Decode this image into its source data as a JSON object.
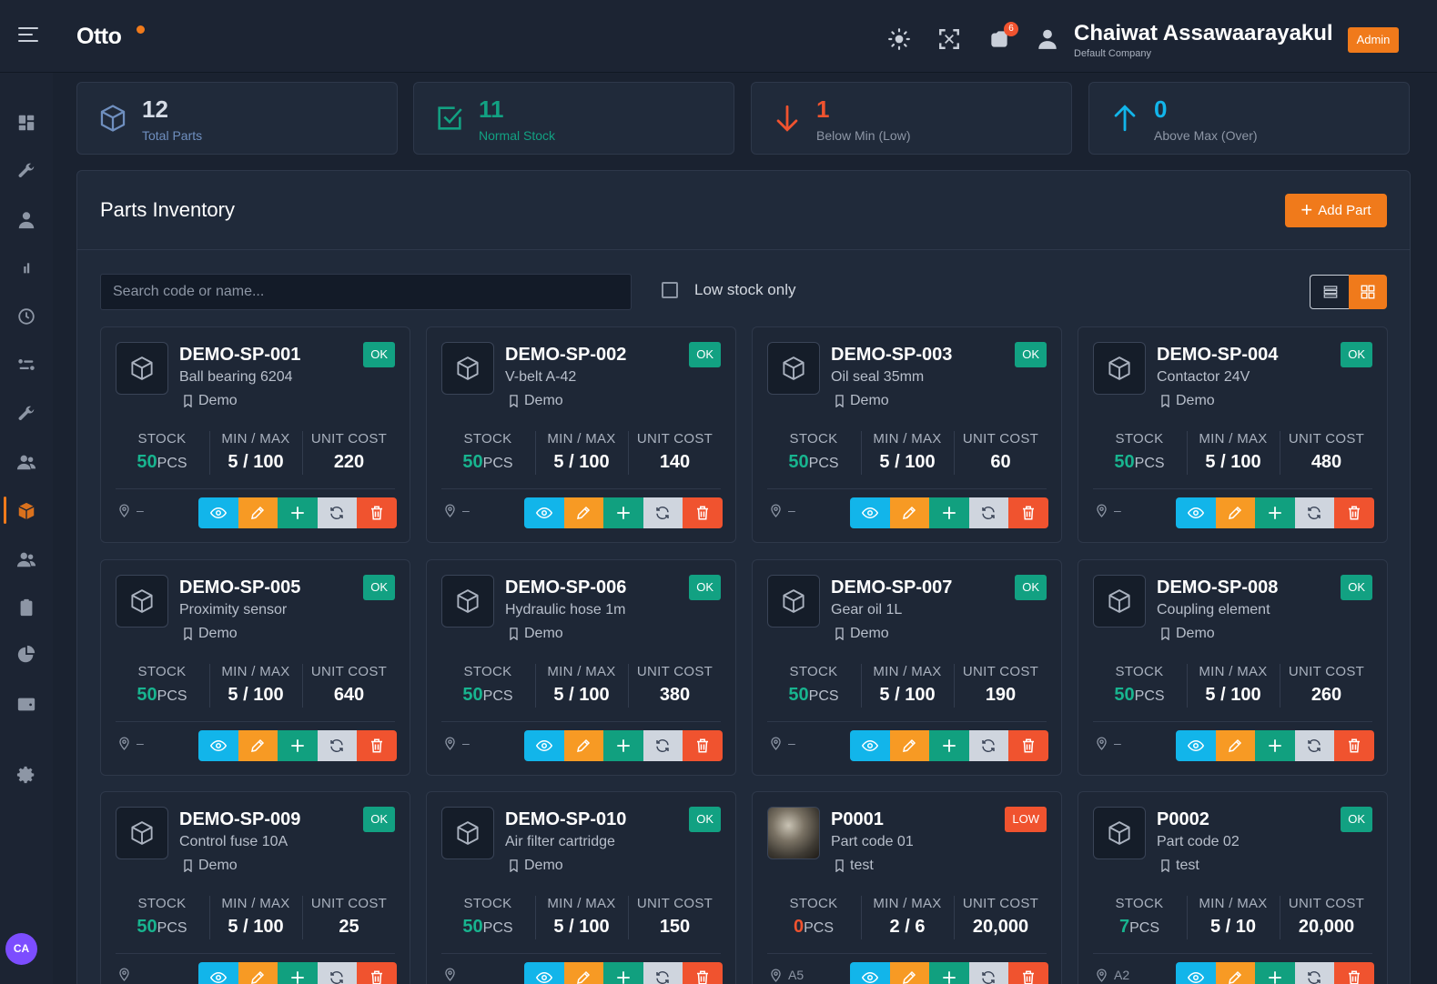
{
  "header": {
    "logo": "Otto",
    "notification_count": "6",
    "user_name": "Chaiwat Assawaarayakul",
    "company": "Default Company",
    "role": "Admin",
    "icons": [
      "menu-icon",
      "sun-icon",
      "fullscreen-icon",
      "notification-icon",
      "user-icon"
    ]
  },
  "sidebar": {
    "items": [
      "dashboard-icon",
      "wrench-icon",
      "user-icon",
      "chart-icon",
      "history-icon",
      "flow-icon",
      "tools-icon",
      "team-icon",
      "box-icon",
      "users-icon",
      "clipboard-icon",
      "pie-icon",
      "wallet-icon",
      "settings-icon"
    ],
    "active": "box-icon",
    "avatar_initials": "CA"
  },
  "stats": [
    {
      "value": "12",
      "label": "Total Parts",
      "color": "#6f8fbf",
      "icon": "box-icon"
    },
    {
      "value": "11",
      "label": "Normal Stock",
      "color": "#12a182",
      "icon": "check-square-icon"
    },
    {
      "value": "1",
      "label": "Below Min (Low)",
      "color": "#f0532f",
      "icon": "arrow-down-icon"
    },
    {
      "value": "0",
      "label": "Above Max (Over)",
      "color": "#12b5ea",
      "icon": "arrow-up-icon"
    }
  ],
  "inventory": {
    "title": "Parts Inventory",
    "add_label": "Add Part",
    "search_placeholder": "Search code or name...",
    "low_stock_label": "Low stock only",
    "col_stock": "STOCK",
    "col_minmax": "MIN / MAX",
    "col_cost": "UNIT COST",
    "parts": [
      {
        "code": "DEMO-SP-001",
        "name": "Ball bearing 6204",
        "location": "Demo",
        "status": "OK",
        "stock": "50",
        "unit": "PCS",
        "minmax": "5 / 100",
        "cost": "220",
        "pin": "–"
      },
      {
        "code": "DEMO-SP-002",
        "name": "V-belt A-42",
        "location": "Demo",
        "status": "OK",
        "stock": "50",
        "unit": "PCS",
        "minmax": "5 / 100",
        "cost": "140",
        "pin": "–"
      },
      {
        "code": "DEMO-SP-003",
        "name": "Oil seal 35mm",
        "location": "Demo",
        "status": "OK",
        "stock": "50",
        "unit": "PCS",
        "minmax": "5 / 100",
        "cost": "60",
        "pin": "–"
      },
      {
        "code": "DEMO-SP-004",
        "name": "Contactor 24V",
        "location": "Demo",
        "status": "OK",
        "stock": "50",
        "unit": "PCS",
        "minmax": "5 / 100",
        "cost": "480",
        "pin": "–"
      },
      {
        "code": "DEMO-SP-005",
        "name": "Proximity sensor",
        "location": "Demo",
        "status": "OK",
        "stock": "50",
        "unit": "PCS",
        "minmax": "5 / 100",
        "cost": "640",
        "pin": "–"
      },
      {
        "code": "DEMO-SP-006",
        "name": "Hydraulic hose 1m",
        "location": "Demo",
        "status": "OK",
        "stock": "50",
        "unit": "PCS",
        "minmax": "5 / 100",
        "cost": "380",
        "pin": "–"
      },
      {
        "code": "DEMO-SP-007",
        "name": "Gear oil 1L",
        "location": "Demo",
        "status": "OK",
        "stock": "50",
        "unit": "PCS",
        "minmax": "5 / 100",
        "cost": "190",
        "pin": "–"
      },
      {
        "code": "DEMO-SP-008",
        "name": "Coupling element",
        "location": "Demo",
        "status": "OK",
        "stock": "50",
        "unit": "PCS",
        "minmax": "5 / 100",
        "cost": "260",
        "pin": "–"
      },
      {
        "code": "DEMO-SP-009",
        "name": "Control fuse 10A",
        "location": "Demo",
        "status": "OK",
        "stock": "50",
        "unit": "PCS",
        "minmax": "5 / 100",
        "cost": "25",
        "pin": ""
      },
      {
        "code": "DEMO-SP-010",
        "name": "Air filter cartridge",
        "location": "Demo",
        "status": "OK",
        "stock": "50",
        "unit": "PCS",
        "minmax": "5 / 100",
        "cost": "150",
        "pin": ""
      },
      {
        "code": "P0001",
        "name": "Part code 01",
        "location": "test",
        "status": "LOW",
        "stock": "0",
        "unit": "PCS",
        "minmax": "2 / 6",
        "cost": "20,000",
        "pin": "A5",
        "photo": true
      },
      {
        "code": "P0002",
        "name": "Part code 02",
        "location": "test",
        "status": "OK",
        "stock": "7",
        "unit": "PCS",
        "minmax": "5 / 10",
        "cost": "20,000",
        "pin": "A2"
      }
    ]
  }
}
